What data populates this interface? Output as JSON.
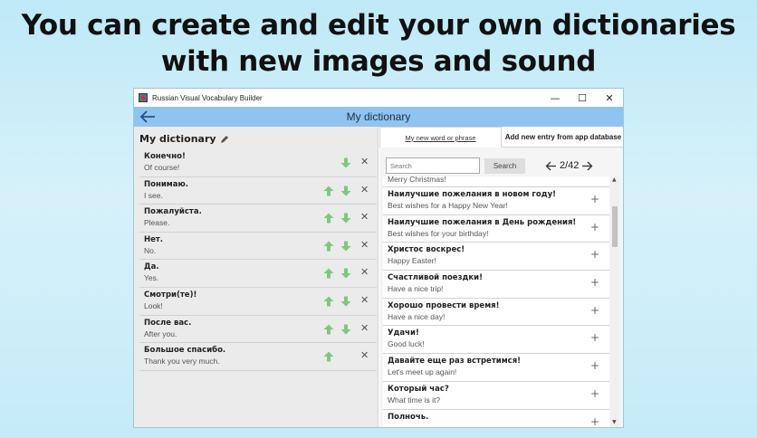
{
  "headline": {
    "line1": "You can create and edit your own dictionaries",
    "line2": "with new images and sound"
  },
  "window": {
    "title": "Russian Visual Vocabulary Builder",
    "minimize": "—",
    "maximize": "☐",
    "close": "✕"
  },
  "appbar": {
    "title": "My dictionary",
    "back_icon": "arrow-left-icon"
  },
  "left_panel": {
    "title": "My dictionary",
    "items": [
      {
        "ru": "Конечно!",
        "en": "Of course!",
        "up": false
      },
      {
        "ru": "Понимаю.",
        "en": "I see.",
        "up": true
      },
      {
        "ru": "Пожалуйста.",
        "en": "Please.",
        "up": true
      },
      {
        "ru": "Нет.",
        "en": "No.",
        "up": true
      },
      {
        "ru": "Да.",
        "en": "Yes.",
        "up": true
      },
      {
        "ru": "Смотри(те)!",
        "en": "Look!",
        "up": true
      },
      {
        "ru": "После вас.",
        "en": "After you.",
        "up": true
      },
      {
        "ru": "Большое спасибо.",
        "en": "Thank you very much.",
        "up": true,
        "down": false
      }
    ]
  },
  "right_panel": {
    "tab_new": "My new word or phrase",
    "tab_db": "Add new entry from app database",
    "search_placeholder": "Search",
    "search_button": "Search",
    "page": "2/42",
    "partial_top": "Merry Christmas!",
    "items": [
      {
        "ru": "Наилучшие пожелания в новом году!",
        "en": "Best wishes for a Happy New Year!"
      },
      {
        "ru": "Наилучшие пожелания в День рождения!",
        "en": "Best wishes for your birthday!"
      },
      {
        "ru": "Христос воскрес!",
        "en": "Happy Easter!"
      },
      {
        "ru": "Счастливой поездки!",
        "en": "Have a nice trip!"
      },
      {
        "ru": "Хорошо провести время!",
        "en": "Have a nice day!"
      },
      {
        "ru": "Удачи!",
        "en": "Good luck!"
      },
      {
        "ru": "Давайте еще раз встретимся!",
        "en": "Let's meet up again!"
      },
      {
        "ru": "Который час?",
        "en": "What time is it?"
      },
      {
        "ru": "Полночь.",
        "en": ""
      }
    ]
  },
  "colors": {
    "appbar": "#8fc4f1",
    "arrow_green": "#7ec87e",
    "panel_bg": "#ebebeb"
  }
}
